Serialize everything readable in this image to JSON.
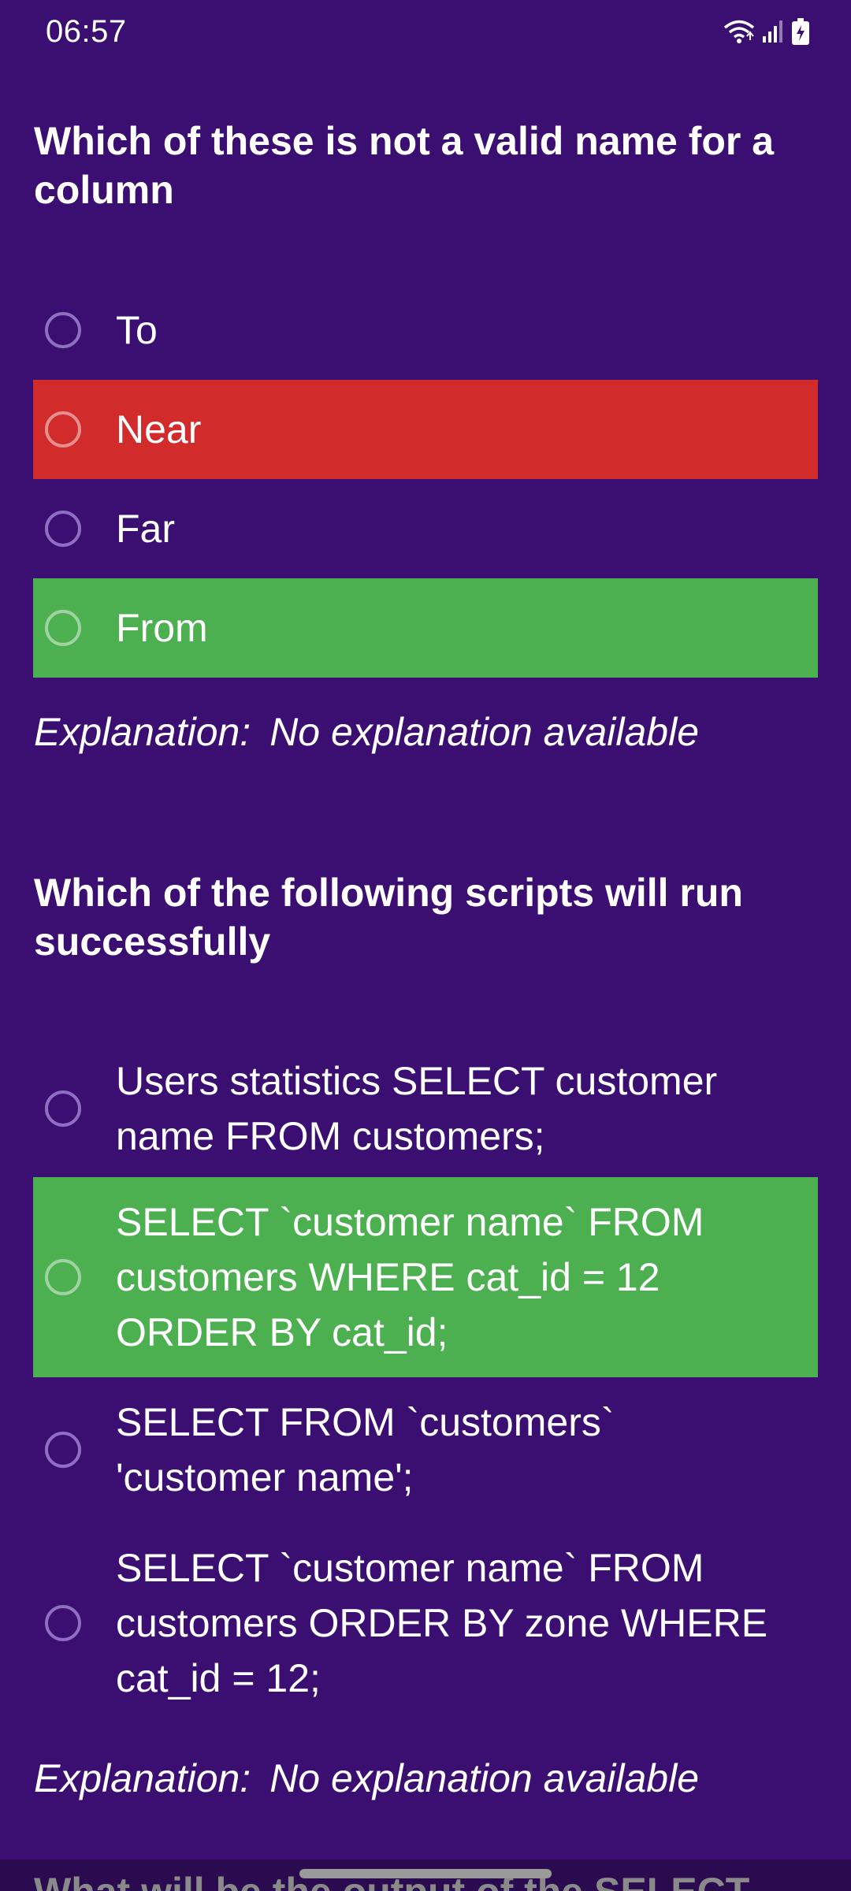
{
  "status_bar": {
    "time": "06:57",
    "icons": [
      "wifi-icon",
      "signal-icon",
      "battery-icon"
    ]
  },
  "questions": [
    {
      "text": "Which of these is not a valid name for a column",
      "options": [
        {
          "label": "To",
          "state": "neutral"
        },
        {
          "label": "Near",
          "state": "wrong"
        },
        {
          "label": "Far",
          "state": "neutral"
        },
        {
          "label": "From",
          "state": "correct"
        }
      ],
      "explanation_label": "Explanation:",
      "explanation_text": "No explanation available"
    },
    {
      "text": "Which of the following scripts will run successfully",
      "options": [
        {
          "label": "Users statistics SELECT customer name FROM customers;",
          "state": "neutral"
        },
        {
          "label": "SELECT `customer name` FROM customers WHERE cat_id = 12 ORDER BY cat_id;",
          "state": "correct"
        },
        {
          "label": "SELECT FROM `customers` 'customer name';",
          "state": "neutral"
        },
        {
          "label": "SELECT `customer name` FROM customers ORDER BY zone WHERE cat_id = 12;",
          "state": "neutral"
        }
      ],
      "explanation_label": "Explanation:",
      "explanation_text": "No explanation available"
    }
  ],
  "next_question_peek": "What will be the output of the SELECT",
  "colors": {
    "background": "#3b0f72",
    "wrong": "#d12b2b",
    "correct": "#4caf50"
  }
}
